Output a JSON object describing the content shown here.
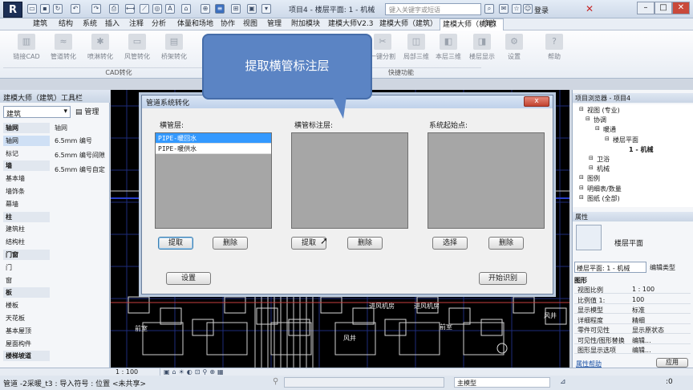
{
  "titlebar": {
    "app_logo": "R",
    "window_title": "项目4 - 楼层平面: 1 - 机械",
    "search_placeholder": "键入关键字或短语",
    "login": "登录"
  },
  "tabs": [
    "建筑",
    "结构",
    "系统",
    "插入",
    "注释",
    "分析",
    "体量和场地",
    "协作",
    "视图",
    "管理",
    "附加模块",
    "建模大师V2.3",
    "建模大师（建筑）",
    "建模大师（机电）",
    "修改"
  ],
  "active_tab": "建模大师（机电）",
  "ribbon": {
    "buttons": [
      "链接CAD",
      "管道转化",
      "喷淋转化",
      "风管转化",
      "桥架转化",
      "管道标注",
      "一键分割",
      "局部三维",
      "本层三维",
      "楼层显示",
      "设置",
      "帮助"
    ],
    "groups": [
      "CAD转化",
      "快捷功能"
    ]
  },
  "callout": "提取横管标注层",
  "left_panel": {
    "title": "建模大师（建筑）工具栏",
    "select": "建筑",
    "manage": "管理",
    "categories": [
      {
        "label": "轴网",
        "head": true
      },
      {
        "label": "轴网",
        "head": false,
        "sel": true
      },
      {
        "label": "标记",
        "head": false
      },
      {
        "label": "墙",
        "head": true
      },
      {
        "label": "基本墙",
        "head": false
      },
      {
        "label": "墙饰条",
        "head": false
      },
      {
        "label": "幕墙",
        "head": false
      },
      {
        "label": "柱",
        "head": true
      },
      {
        "label": "建筑柱",
        "head": false
      },
      {
        "label": "结构柱",
        "head": false
      },
      {
        "label": "门窗",
        "head": true
      },
      {
        "label": "门",
        "head": false
      },
      {
        "label": "窗",
        "head": false
      },
      {
        "label": "板",
        "head": true
      },
      {
        "label": "楼板",
        "head": false
      },
      {
        "label": "天花板",
        "head": false
      },
      {
        "label": "基本屋顶",
        "head": false
      },
      {
        "label": "屋面构件",
        "head": false
      },
      {
        "label": "楼梯坡道",
        "head": true
      }
    ],
    "sub_header": "轴网",
    "sub_items": [
      "6.5mm 编号",
      "6.5mm 编号间隙",
      "6.5mm 编号自定"
    ]
  },
  "dialog": {
    "title": "管道系统转化",
    "col1_label": "横管层:",
    "col2_label": "横管标注层:",
    "col3_label": "系统起始点:",
    "list1": [
      "PIPE-暖回水",
      "PIPE-暖供水"
    ],
    "btn_extract": "提取",
    "btn_delete": "删除",
    "btn_select": "选择",
    "btn_settings": "设置",
    "btn_start": "开始识别",
    "close": "x"
  },
  "project_browser": {
    "title": "项目浏览器 - 项目4",
    "nodes": [
      "视图 (专业)",
      "协调",
      "暖通",
      "楼层平面",
      "1 - 机械",
      "卫浴",
      "机械",
      "图例",
      "明细表/数量",
      "图纸 (全部)"
    ]
  },
  "properties": {
    "title": "属性",
    "type_name": "楼层平面",
    "selector": "楼层平面: 1 - 机械",
    "edit_type": "编辑类型",
    "section": "图形",
    "rows": [
      [
        "视图比例",
        "1 : 100"
      ],
      [
        "比例值 1:",
        "100"
      ],
      [
        "显示模型",
        "标准"
      ],
      [
        "详细程度",
        "精细"
      ],
      [
        "零件可见性",
        "显示原状态"
      ],
      [
        "可见性/图形替换",
        "编辑..."
      ],
      [
        "图形显示选项",
        "编辑..."
      ]
    ],
    "help": "属性帮助",
    "apply": "应用"
  },
  "canvas_labels": [
    "进风机房",
    "进风机房",
    "风井",
    "前室",
    "风井",
    "前室"
  ],
  "view_bar": {
    "scale": "1 : 100"
  },
  "status": {
    "text": "管道 -2采暖_t3 : 导入符号 : 位置 <未共享>",
    "model": "主模型",
    "zero": ":0"
  }
}
